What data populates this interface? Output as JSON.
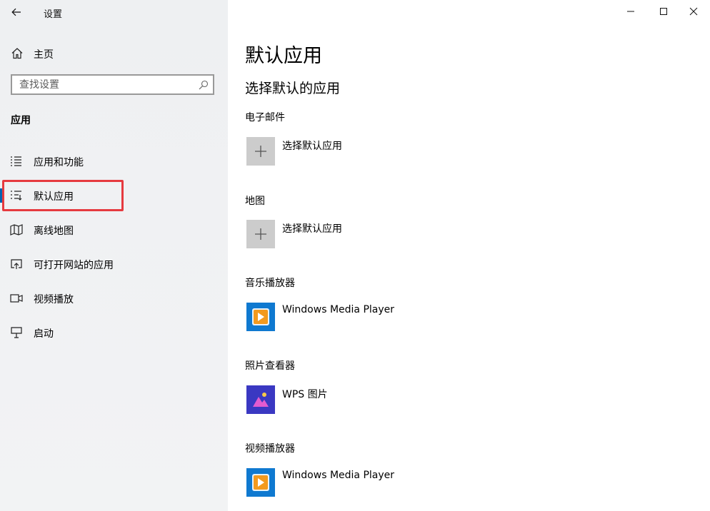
{
  "window": {
    "title": "设置",
    "controls": {
      "minimize": "minimize-icon",
      "maximize": "maximize-icon",
      "close": "close-icon"
    }
  },
  "sidebar": {
    "home_label": "主页",
    "search_placeholder": "查找设置",
    "section_heading": "应用",
    "items": [
      {
        "label": "应用和功能",
        "icon": "apps-features-icon",
        "active": false
      },
      {
        "label": "默认应用",
        "icon": "default-apps-icon",
        "active": true
      },
      {
        "label": "离线地图",
        "icon": "offline-maps-icon",
        "active": false
      },
      {
        "label": "可打开网站的应用",
        "icon": "apps-for-websites-icon",
        "active": false
      },
      {
        "label": "视频播放",
        "icon": "video-playback-icon",
        "active": false
      },
      {
        "label": "启动",
        "icon": "startup-icon",
        "active": false
      }
    ],
    "highlight_color": "#e63a3f"
  },
  "main": {
    "title": "默认应用",
    "subtitle": "选择默认的应用",
    "categories": [
      {
        "label": "电子邮件",
        "app": "选择默认应用",
        "icon": "plus-icon"
      },
      {
        "label": "地图",
        "app": "选择默认应用",
        "icon": "plus-icon"
      },
      {
        "label": "音乐播放器",
        "app": "Windows Media Player",
        "icon": "windows-media-player-icon"
      },
      {
        "label": "照片查看器",
        "app": "WPS 图片",
        "icon": "wps-pictures-icon"
      },
      {
        "label": "视频播放器",
        "app": "Windows Media Player",
        "icon": "windows-media-player-icon"
      }
    ]
  },
  "colors": {
    "accent": "#0063b1",
    "sidebar_bg": "#f0f1f3",
    "plus_tile": "#cccccc",
    "wmp_tile": "#0f79d0",
    "wps_tile": "#3a38c2"
  }
}
